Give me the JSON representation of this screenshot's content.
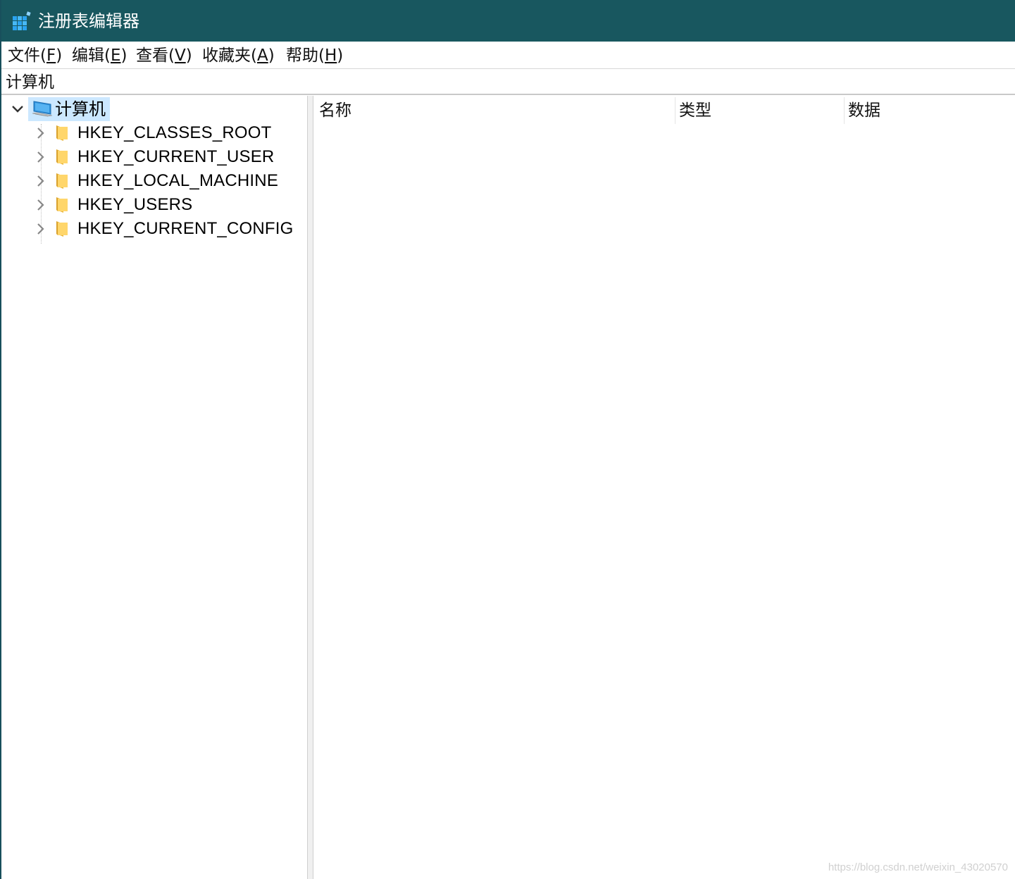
{
  "window": {
    "title": "注册表编辑器",
    "icon": "registry-editor-icon",
    "title_bar_color": "#18575f"
  },
  "menu": [
    {
      "text": "文件(",
      "key": "F",
      "tail": ")"
    },
    {
      "text": "编辑(",
      "key": "E",
      "tail": ")"
    },
    {
      "text": "查看(",
      "key": "V",
      "tail": ")"
    },
    {
      "text": "收藏夹(",
      "key": "A",
      "tail": ")"
    },
    {
      "text": "帮助(",
      "key": "H",
      "tail": ")"
    }
  ],
  "address": "计算机",
  "tree": {
    "root": {
      "label": "计算机",
      "icon": "computer-icon",
      "expanded": true,
      "selected": true,
      "selection_color": "#cce8ff"
    },
    "children": [
      {
        "label": "HKEY_CLASSES_ROOT",
        "icon": "folder-icon"
      },
      {
        "label": "HKEY_CURRENT_USER",
        "icon": "folder-icon"
      },
      {
        "label": "HKEY_LOCAL_MACHINE",
        "icon": "folder-icon"
      },
      {
        "label": "HKEY_USERS",
        "icon": "folder-icon"
      },
      {
        "label": "HKEY_CURRENT_CONFIG",
        "icon": "folder-icon"
      }
    ]
  },
  "list": {
    "columns": [
      "名称",
      "类型",
      "数据"
    ]
  },
  "watermark": "https://blog.csdn.net/weixin_43020570"
}
